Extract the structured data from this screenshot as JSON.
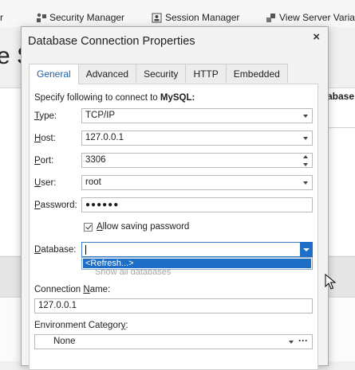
{
  "toolbar": {
    "partial_item": "r",
    "security_manager": "Security Manager",
    "session_manager": "Session Manager",
    "view_server_variables": "View Server Variable"
  },
  "background": {
    "big_heading": "e S",
    "right_header": "abase"
  },
  "dialog": {
    "title": "Database Connection Properties",
    "close_label": "×",
    "tabs": [
      "General",
      "Advanced",
      "Security",
      "HTTP",
      "Embedded"
    ],
    "active_tab": "General",
    "intro_prefix": "Specify following to connect to ",
    "intro_db": "MySQL:",
    "fields": {
      "type": {
        "label_u": "T",
        "label_rest": "ype:",
        "value": "TCP/IP"
      },
      "host": {
        "label_u": "H",
        "label_rest": "ost:",
        "value": "127.0.0.1"
      },
      "port": {
        "label_u": "P",
        "label_rest": "ort:",
        "value": "3306"
      },
      "user": {
        "label_u": "U",
        "label_rest": "ser:",
        "value": "root"
      },
      "password": {
        "label_u": "P",
        "label_rest": "assword:",
        "value": "●●●●●●"
      },
      "database": {
        "label_u": "D",
        "label_rest": "atabase:",
        "value": ""
      }
    },
    "allow_saving": {
      "label_u": "A",
      "label_rest": "llow saving password",
      "checked": true
    },
    "database_dropdown": {
      "options": [
        "<Refresh...>"
      ],
      "highlighted": "<Refresh...>"
    },
    "show_all_databases": "Show all databases",
    "connection_name": {
      "label_pre": "Connection ",
      "label_u": "N",
      "label_rest": "ame:",
      "value": "127.0.0.1"
    },
    "environment_category": {
      "label_pre": "Environment Categor",
      "label_u": "y",
      "label_rest": ":",
      "value": "None",
      "more": "···"
    }
  }
}
